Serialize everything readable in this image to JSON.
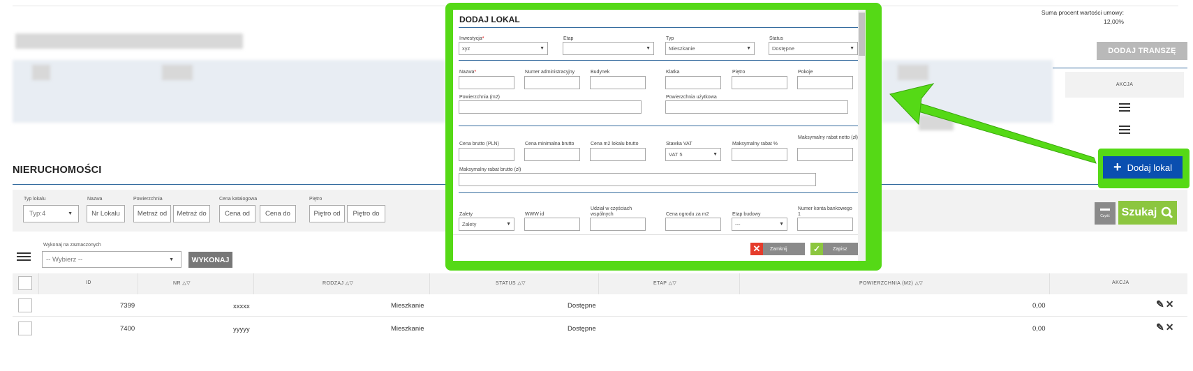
{
  "summary": {
    "label": "Suma procent wartości umowy:",
    "value": "12,00%"
  },
  "top_buttons": {
    "dodaj_transze": "DODAJ TRANSZĘ",
    "akcja_header": "AKCJA"
  },
  "page_title": "NIERUCHOMOŚCI",
  "filters": {
    "typ_lokalu": {
      "label": "Typ lokalu",
      "value": "Typ:4"
    },
    "nazwa": {
      "label": "Nazwa",
      "placeholder": "Nr Lokalu"
    },
    "powierzchnia": {
      "label": "Powierzchnia",
      "from": "Metraż od",
      "to": "Metraż do"
    },
    "cena": {
      "label": "Cena katalogowa",
      "from": "Cena od",
      "to": "Cena do"
    },
    "pietro": {
      "label": "Piętro",
      "from": "Piętro od",
      "to": "Piętro do"
    },
    "clear_label": "Czyść",
    "search_label": "Szukaj"
  },
  "bulk": {
    "label": "Wykonaj na zaznaczonych",
    "select_value": "-- Wybierz --",
    "button": "WYKONAJ"
  },
  "table": {
    "headers": {
      "id": "ID",
      "nr": "NR",
      "rodzaj": "RODZAJ",
      "status": "STATUS",
      "etap": "ETAP",
      "powierzchnia": "POWIERZCHNIA (M2)",
      "akcja": "AKCJA"
    },
    "sort_glyph": "△▽",
    "rows": [
      {
        "id": "7399",
        "nr": "xxxxx",
        "rodzaj": "Mieszkanie",
        "status": "Dostępne",
        "etap": "",
        "powierzchnia": "0,00"
      },
      {
        "id": "7400",
        "nr": "yyyyy",
        "rodzaj": "Mieszkanie",
        "status": "Dostępne",
        "etap": "",
        "powierzchnia": "0,00"
      }
    ]
  },
  "dodaj_lokal_button": "Dodaj lokal",
  "modal": {
    "title": "DODAJ LOKAL",
    "inwestycja": {
      "label": "Inwestycja",
      "value": "xyz"
    },
    "etap": {
      "label": "Etap",
      "value": ""
    },
    "typ": {
      "label": "Typ",
      "value": "Mieszkanie"
    },
    "status": {
      "label": "Status",
      "value": "Dostępne"
    },
    "nazwa": "Nazwa",
    "numer_administracyjny": "Numer administracyjny",
    "budynek": "Budynek",
    "klatka": "Klatka",
    "pietro": "Piętro",
    "pokoje": "Pokoje",
    "powierzchnia": "Powierzchnia (m2)",
    "powierzchnia_uzytkowa": "Powierzchnia użytkowa",
    "cena_brutto": "Cena brutto (PLN)",
    "cena_min": "Cena minimalna brutto",
    "cena_m2": "Cena m2 lokalu brutto",
    "stawka_vat": {
      "label": "Stawka VAT",
      "value": "VAT 5"
    },
    "maks_rabat_proc": "Maksymalny rabat %",
    "maks_rabat_netto": "Maksymalny rabat netto (zł)",
    "maks_rabat_brutto": "Maksymalny rabat brutto (zł)",
    "zalety": {
      "label": "Zalety",
      "value": "Zalety"
    },
    "www_id": "WWW id",
    "udzial": "Udział w częściach wspólnych",
    "cena_ogrodu": "Cena ogrodu za m2",
    "etap_budowy": {
      "label": "Etap budowy",
      "value": "---"
    },
    "numer_konta": "Numer konta bankowego 1",
    "zamknij": "Zamknij",
    "zapisz": "Zapisz"
  },
  "colors": {
    "highlight": "#55d916",
    "primary": "#0a4fb0",
    "search_green": "#8cc63f",
    "close_red": "#e53c2c"
  }
}
